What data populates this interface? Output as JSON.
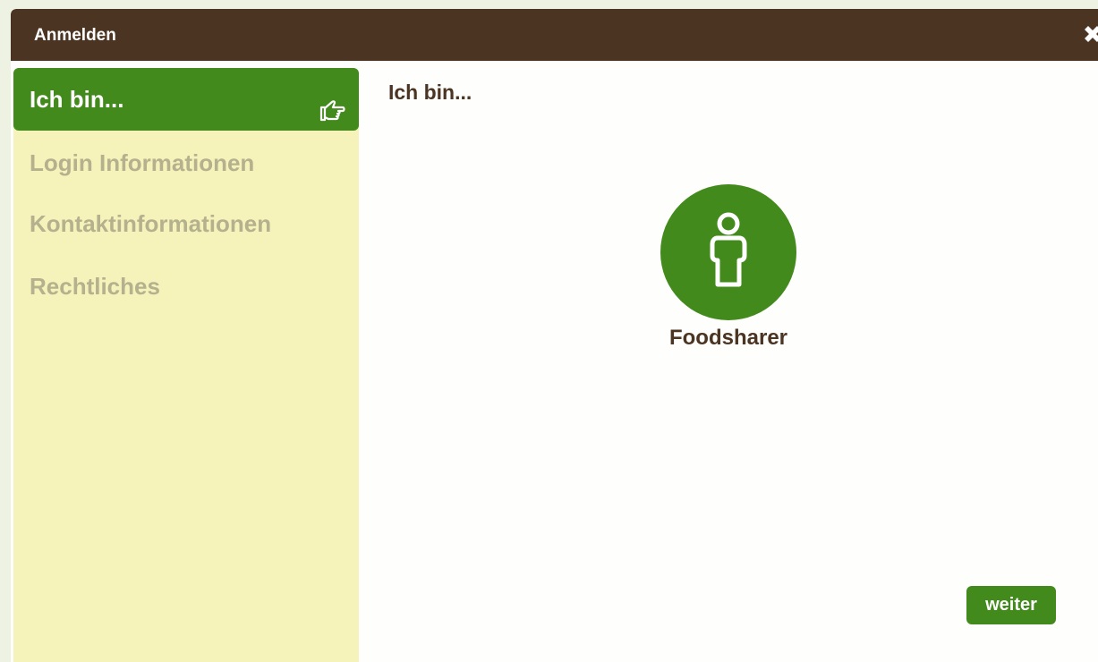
{
  "dialog": {
    "title": "Anmelden",
    "close_icon": "close-x-icon"
  },
  "sidebar": {
    "items": [
      {
        "label": "Ich bin...",
        "active": true,
        "icon": "hand-pointing-icon"
      },
      {
        "label": "Login Informationen",
        "active": false
      },
      {
        "label": "Kontaktinformationen",
        "active": false
      },
      {
        "label": "Rechtliches",
        "active": false
      }
    ]
  },
  "main": {
    "heading": "Ich bin...",
    "choice": {
      "label": "Foodsharer",
      "icon": "person-icon"
    },
    "next_label": "weiter"
  },
  "colors": {
    "titlebar": "#4b3422",
    "accent_green": "#438a1c",
    "sidebar_bg": "#f5f3b9",
    "inactive_text": "#b5b08e",
    "heading_text": "#4b3422"
  }
}
